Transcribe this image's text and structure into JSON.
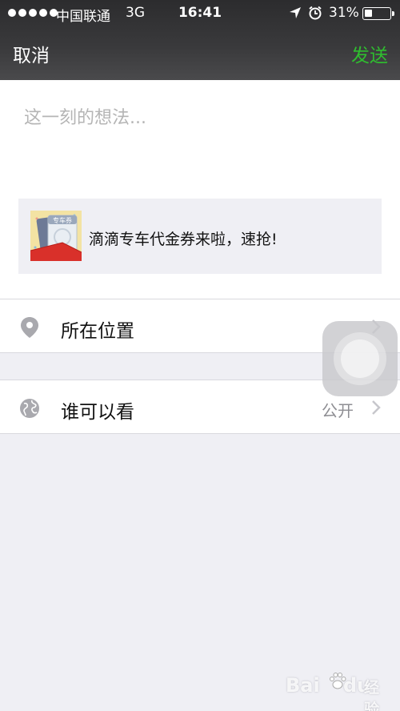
{
  "status_bar": {
    "carrier": "中国联通",
    "network": "3G",
    "time": "16:41",
    "battery_percent": "31%",
    "battery_level": 0.31,
    "icons": [
      "location-arrow-icon",
      "alarm-clock-icon",
      "battery-icon"
    ]
  },
  "nav": {
    "cancel_label": "取消",
    "send_label": "发送",
    "send_color": "#2fbd2f"
  },
  "composer": {
    "placeholder": "这一刻的想法...",
    "value": ""
  },
  "share_card": {
    "thumb_text": "专车券",
    "text": "滴滴专车代金券来啦，速抢!"
  },
  "rows": {
    "location": {
      "label": "所在位置",
      "icon": "location-pin-icon"
    },
    "visibility": {
      "label": "谁可以看",
      "value": "公开",
      "icon": "globe-icon"
    }
  },
  "watermark": {
    "bai": "Bai",
    "du": "du",
    "jingyan": "经验"
  }
}
